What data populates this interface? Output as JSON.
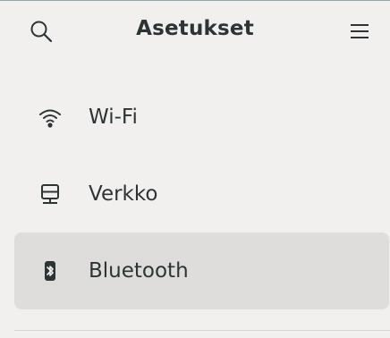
{
  "header": {
    "title": "Asetukset",
    "search_icon": "search-icon",
    "menu_icon": "hamburger-menu-icon"
  },
  "sidebar": {
    "items": [
      {
        "label": "Wi-Fi",
        "icon": "wifi-icon",
        "selected": false
      },
      {
        "label": "Verkko",
        "icon": "network-icon",
        "selected": false
      },
      {
        "label": "Bluetooth",
        "icon": "bluetooth-icon",
        "selected": true
      }
    ]
  },
  "colors": {
    "background": "#f1f0ef",
    "selected_background": "#dedddb",
    "text": "#2e3436"
  }
}
